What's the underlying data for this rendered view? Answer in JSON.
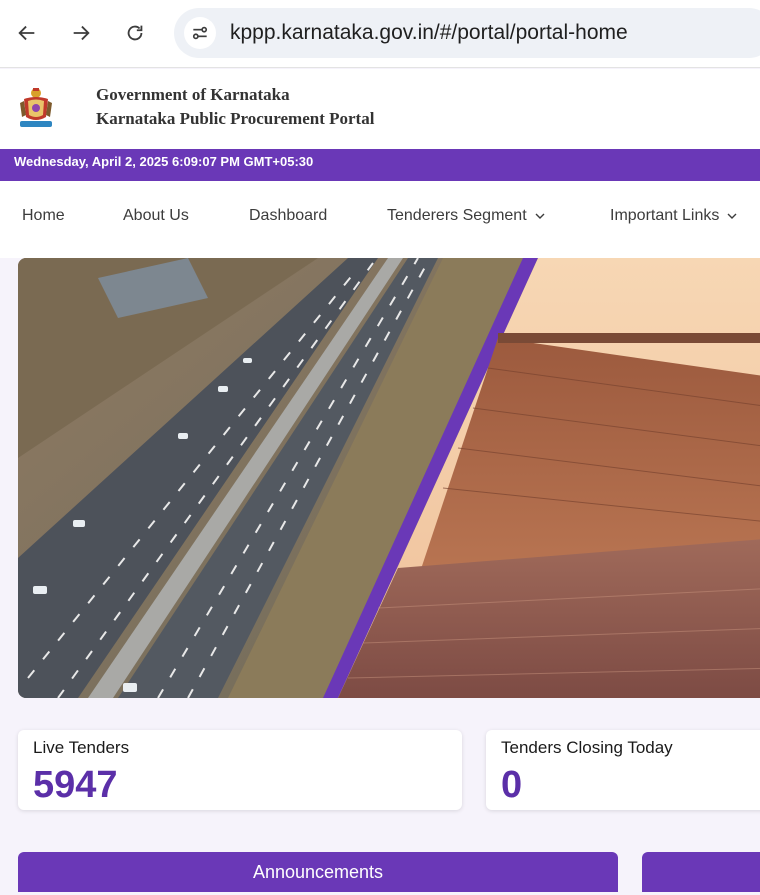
{
  "browser": {
    "url": "kppp.karnataka.gov.in/#/portal/portal-home",
    "icons": [
      "back-icon",
      "forward-icon",
      "reload-icon",
      "site-info-icon"
    ]
  },
  "header": {
    "government": "Government of Karnataka",
    "portal": "Karnataka Public Procurement Portal"
  },
  "datebar": {
    "datetime": "Wednesday, April 2, 2025 6:09:07 PM GMT+05:30"
  },
  "menu": {
    "items": [
      {
        "label": "Home"
      },
      {
        "label": "About Us"
      },
      {
        "label": "Dashboard"
      },
      {
        "label": "Tenderers Segment"
      },
      {
        "label": "Important Links"
      }
    ]
  },
  "stats": [
    {
      "label": "Live Tenders",
      "value": "5947"
    },
    {
      "label": "Tenders Closing Today",
      "value": "0"
    }
  ],
  "announcements": {
    "label": "Announcements"
  },
  "colors": {
    "brand": "#6a38b7",
    "stat_value": "#5b2fa8"
  }
}
